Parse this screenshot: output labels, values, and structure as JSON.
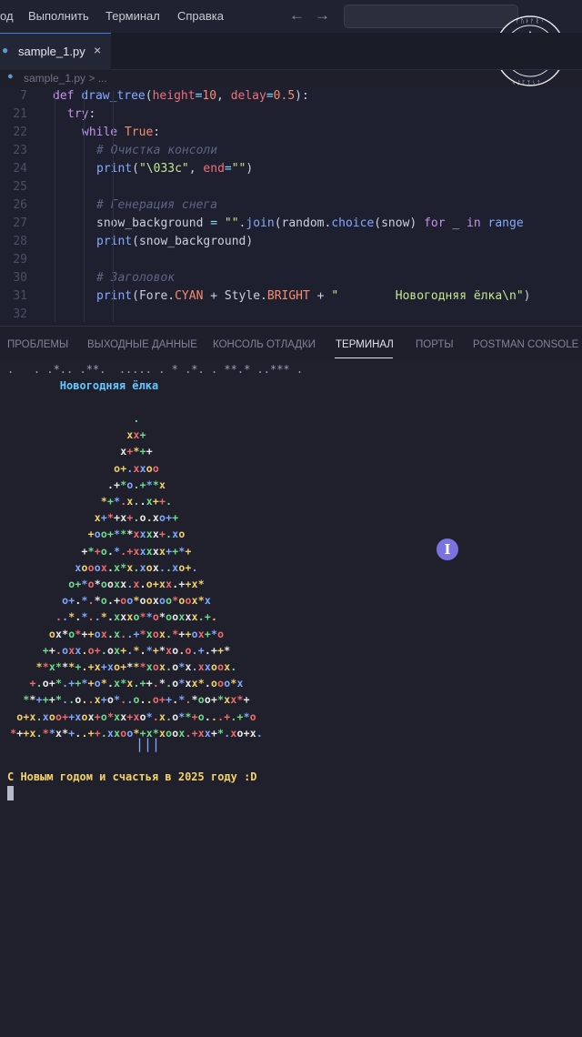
{
  "menubar": {
    "items": [
      "од",
      "Выполнить",
      "Терминал",
      "Справка"
    ],
    "back_icon": "arrow-left-icon",
    "forward_icon": "arrow-right-icon",
    "search_placeholder": ""
  },
  "tabs": [
    {
      "label": "sample_1.py",
      "icon": "python-icon",
      "close": "×"
    }
  ],
  "breadcrumb": {
    "file": "sample_1.py",
    "more": " > ..."
  },
  "code": [
    {
      "ln": "7",
      "tokens": [
        [
          "kw",
          "def "
        ],
        [
          "fn",
          "draw_tree"
        ],
        [
          "var",
          "("
        ],
        [
          "par",
          "height"
        ],
        [
          "op",
          "="
        ],
        [
          "num",
          "10"
        ],
        [
          "var",
          ", "
        ],
        [
          "par",
          "delay"
        ],
        [
          "op",
          "="
        ],
        [
          "num",
          "0.5"
        ],
        [
          "var",
          "):"
        ]
      ]
    },
    {
      "ln": "21",
      "indent": 2,
      "tokens": [
        [
          "kw",
          "try"
        ],
        [
          "var",
          ":"
        ]
      ]
    },
    {
      "ln": "22",
      "indent": 4,
      "tokens": [
        [
          "kw",
          "while "
        ],
        [
          "num",
          "True"
        ],
        [
          "var",
          ":"
        ]
      ]
    },
    {
      "ln": "23",
      "indent": 6,
      "tokens": [
        [
          "com",
          "# Очистка консоли"
        ]
      ]
    },
    {
      "ln": "24",
      "indent": 6,
      "tokens": [
        [
          "fn",
          "print"
        ],
        [
          "var",
          "("
        ],
        [
          "str",
          "\"\\033c\""
        ],
        [
          "var",
          ", "
        ],
        [
          "par",
          "end"
        ],
        [
          "op",
          "="
        ],
        [
          "str",
          "\"\""
        ],
        [
          "var",
          ")"
        ]
      ]
    },
    {
      "ln": "25",
      "tokens": []
    },
    {
      "ln": "26",
      "indent": 6,
      "tokens": [
        [
          "com",
          "# Генерация снега"
        ]
      ]
    },
    {
      "ln": "27",
      "indent": 6,
      "tokens": [
        [
          "var",
          "snow_background "
        ],
        [
          "op",
          "= "
        ],
        [
          "str",
          "\"\""
        ],
        [
          "var",
          "."
        ],
        [
          "fn",
          "join"
        ],
        [
          "var",
          "(random."
        ],
        [
          "fn",
          "choice"
        ],
        [
          "var",
          "(snow) "
        ],
        [
          "kw",
          "for"
        ],
        [
          "var",
          " _ "
        ],
        [
          "kw",
          "in"
        ],
        [
          "var",
          " "
        ],
        [
          "fn",
          "range"
        ]
      ]
    },
    {
      "ln": "28",
      "indent": 6,
      "tokens": [
        [
          "fn",
          "print"
        ],
        [
          "var",
          "(snow_background)"
        ]
      ]
    },
    {
      "ln": "29",
      "tokens": []
    },
    {
      "ln": "30",
      "indent": 6,
      "tokens": [
        [
          "com",
          "# Заголовок"
        ]
      ]
    },
    {
      "ln": "31",
      "indent": 6,
      "tokens": [
        [
          "fn",
          "print"
        ],
        [
          "var",
          "(Fore."
        ],
        [
          "num",
          "CYAN"
        ],
        [
          "var",
          " + Style."
        ],
        [
          "num",
          "BRIGHT"
        ],
        [
          "var",
          " + "
        ],
        [
          "str",
          "\"        Новогодняя ёлка\\n\""
        ],
        [
          "var",
          ")"
        ]
      ]
    },
    {
      "ln": "32",
      "tokens": []
    }
  ],
  "panel_tabs": [
    {
      "label": "ПРОБЛЕМЫ",
      "active": false
    },
    {
      "label": "ВЫХОДНЫЕ ДАННЫЕ",
      "active": false
    },
    {
      "label": "КОНСОЛЬ ОТЛАДКИ",
      "active": false
    },
    {
      "label": "ТЕРМИНАЛ",
      "active": true
    },
    {
      "label": "ПОРТЫ",
      "active": false
    },
    {
      "label": "POSTMAN CONSOLE",
      "active": false
    }
  ],
  "terminal": {
    "snow_line": ".   . .*.. .**.  ..... . * .*. . **.* ..*** .",
    "title": "        Новогодняя ёлка",
    "tree": [
      ".",
      "xx+",
      "x+*++",
      "o+.xxoo",
      ".+*o.+**x",
      "*+*.x..x++.",
      "x+*+x+.o.xo++",
      "+oo+***xxxx+.xo",
      "+*+o.*.+xxxxx++*+",
      "xooox.x*x.xox..xo+.",
      "o+*o*ooxx.x.o+xx.++x*",
      "o+.*.*o.+oo*ooxoo*oox*x",
      "..*.*..*.xxxo**o*ooxxx.+.",
      "ox*o*++ox.x..+*xox.*++ox+*o",
      "++.oxx.o+.ox+.*.*+*xo.o.+.++*",
      "**x***+.+x+xo+***xox.o*x.xxoox.",
      "+.o+*.++*+o*.x*x.++.*.o*xx*.ooo*x",
      "**+++*..o..x+o*..o..o++.*.*oo+*xx*+",
      "o+x.xoo++xox+o*xx+xo*.x.o**+o...+.+*o",
      "*++x.**x*+..++.xxoo*+x*xoox.+xx+*.xo+x."
    ],
    "trunk": "|||",
    "greeting": "С Новым годом и счастья в 2025 году :D"
  },
  "colors": {
    "red": "#ef6b6b",
    "green": "#6fdc8c",
    "yellow": "#f2d16a",
    "blue": "#7fa8ff",
    "cyan": "#64c8ff",
    "white": "#e8e8e8"
  },
  "icons": {
    "logo": "valknut-rune-logo",
    "text_cursor": "text-cursor-icon"
  }
}
